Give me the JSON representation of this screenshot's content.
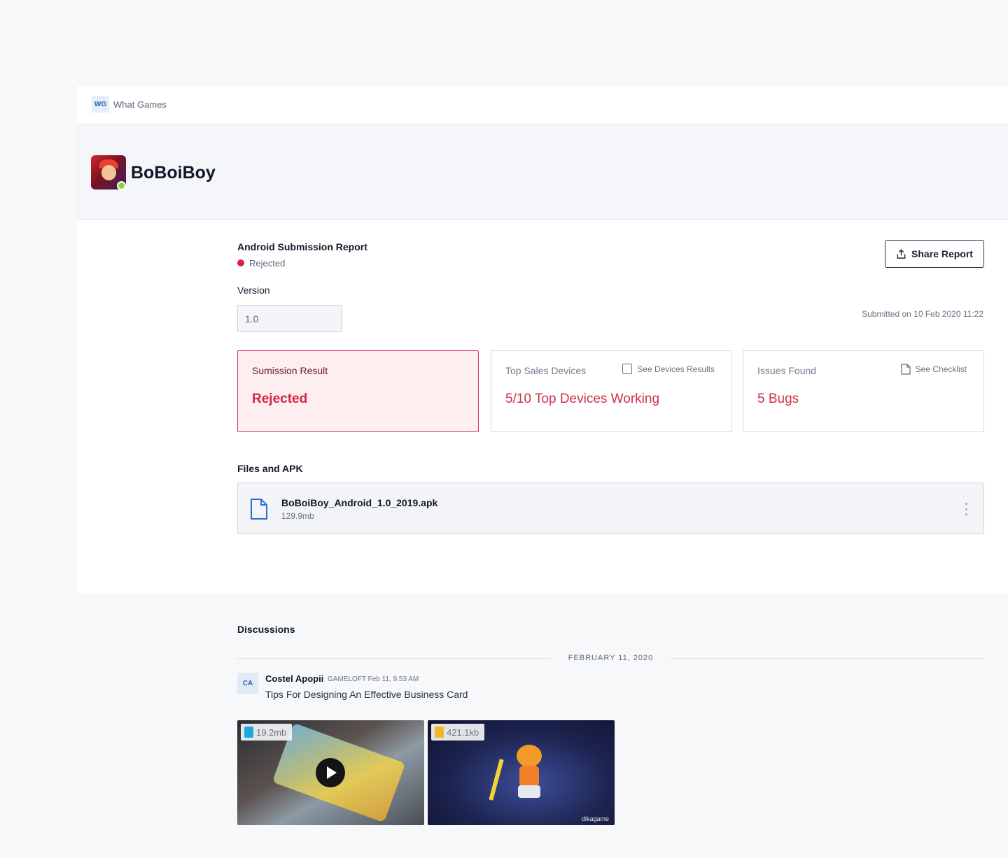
{
  "workspace": {
    "badge": "WG",
    "name": "What Games"
  },
  "app": {
    "title": "BoBoiBoy"
  },
  "report": {
    "title": "Android Submission Report",
    "status": "Rejected",
    "status_color": "#dd1e3f",
    "share_label": "Share Report",
    "version_label": "Version",
    "version_value": "1.0",
    "submitted": "Submitted on 10 Feb 2020 11:22"
  },
  "cards": {
    "result": {
      "label": "Sumission Result",
      "value": "Rejected"
    },
    "devices": {
      "label": "Top Sales Devices",
      "link": "See Devices Results",
      "value": "5/10 Top Devices Working"
    },
    "issues": {
      "label": "Issues Found",
      "link": "See Checklist",
      "value": "5 Bugs"
    }
  },
  "files": {
    "title": "Files and APK",
    "items": [
      {
        "name": "BoBoiBoy_Android_1.0_2019.apk",
        "size": "129.9mb"
      }
    ]
  },
  "discussions": {
    "title": "Discussions",
    "date": "FEBRUARY 11, 2020",
    "comments": [
      {
        "avatar": "CA",
        "author": "Costel Apopii",
        "meta": "GAMELOFT Feb 11, 9:53 AM",
        "message": "Tips For Designing An Effective Business Card",
        "attachments": [
          {
            "type": "video",
            "size": "19.2mb",
            "icon": "mp4-file-icon"
          },
          {
            "type": "image",
            "size": "421.1kb",
            "icon": "jpg-file-icon",
            "watermark": "dikagame"
          }
        ]
      }
    ]
  },
  "colors": {
    "accent_red": "#d52445",
    "brand_blue": "#2b5fb3"
  }
}
